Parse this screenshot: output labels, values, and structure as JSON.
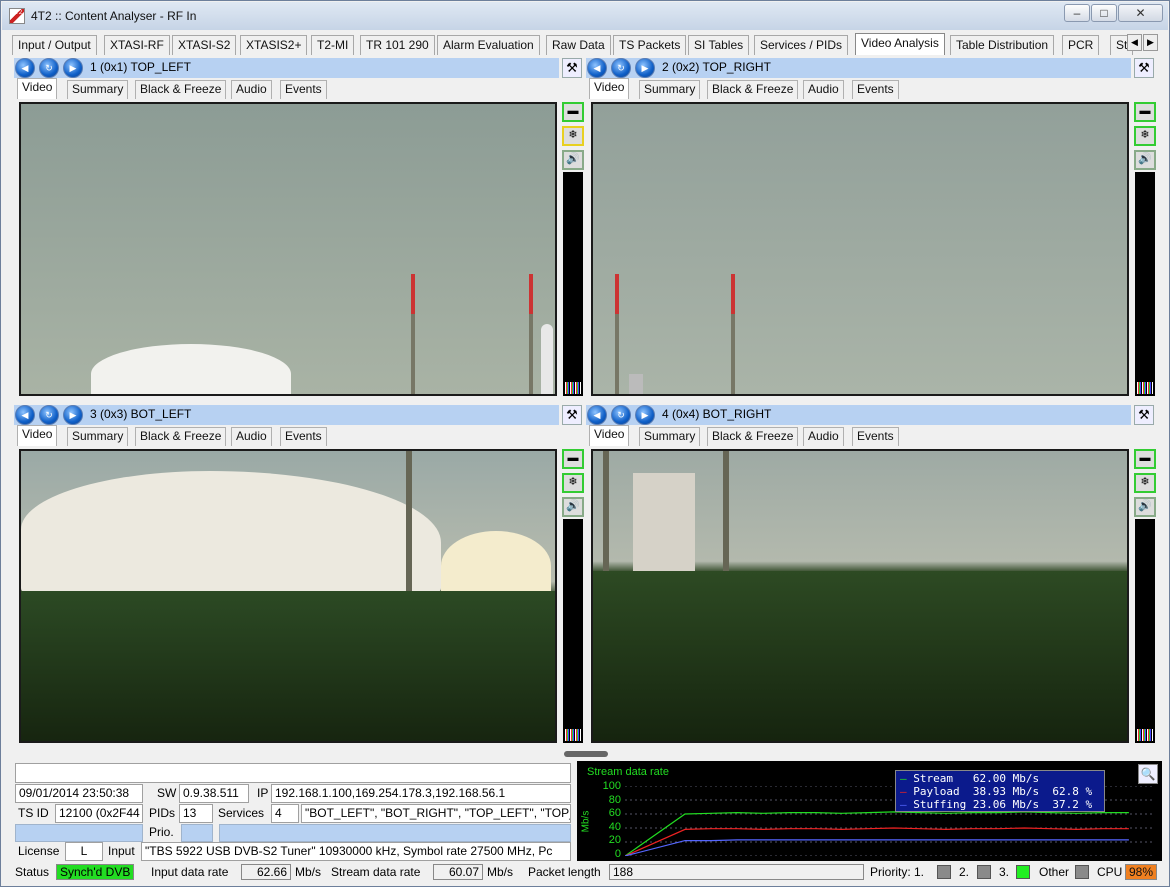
{
  "window": {
    "title": "4T2 :: Content Analyser - RF In",
    "icon": "app-logo-icon"
  },
  "controls": {
    "minimize": "–",
    "maximize": "□",
    "close": "✕"
  },
  "main_tabs": [
    {
      "label": "Input / Output"
    },
    {
      "label": "XTASI-RF"
    },
    {
      "label": "XTASI-S2"
    },
    {
      "label": "XTASIS2+"
    },
    {
      "label": "T2-MI"
    },
    {
      "label": "TR 101 290"
    },
    {
      "label": "Alarm Evaluation"
    },
    {
      "label": "Raw Data"
    },
    {
      "label": "TS Packets"
    },
    {
      "label": "SI Tables"
    },
    {
      "label": "Services / PIDs"
    },
    {
      "label": "Video Analysis",
      "active": true
    },
    {
      "label": "Table Distribution"
    },
    {
      "label": "PCR"
    },
    {
      "label": "St"
    }
  ],
  "panels": [
    {
      "label": "1 (0x1) TOP_LEFT"
    },
    {
      "label": "2 (0x2) TOP_RIGHT"
    },
    {
      "label": "3 (0x3) BOT_LEFT"
    },
    {
      "label": "4 (0x4) BOT_RIGHT"
    }
  ],
  "panel_tabs": [
    "Video",
    "Summary",
    "Black & Freeze",
    "Audio",
    "Events"
  ],
  "info": {
    "datetime": "09/01/2014 23:50:38",
    "sw_label": "SW",
    "sw": "0.9.38.511",
    "ip_label": "IP",
    "ip": "192.168.1.100,169.254.178.3,192.168.56.1",
    "tsid_label": "TS ID",
    "tsid": "12100 (0x2F44",
    "pids_label": "PIDs",
    "pids": "13",
    "services_label": "Services",
    "services": "4",
    "services_list": "\"BOT_LEFT\", \"BOT_RIGHT\", \"TOP_LEFT\", \"TOP_",
    "prio_label": "Prio.",
    "license_label": "License",
    "license": "L",
    "input_label": "Input",
    "input": "\"TBS 5922 USB DVB-S2 Tuner\" 10930000 kHz, Symbol rate 27500 MHz, Pc"
  },
  "graph": {
    "title": "Stream data rate",
    "ylabel": "Mb/s",
    "yticks": [
      "100",
      "80",
      "60",
      "40",
      "20",
      "0"
    ],
    "legend": [
      {
        "name": "Stream",
        "value": "62.00 Mb/s",
        "pct": "",
        "color": "#22dd22"
      },
      {
        "name": "Payload",
        "value": "38.93 Mb/s",
        "pct": "62.8 %",
        "color": "#ee2222"
      },
      {
        "name": "Stuffing",
        "value": "23.06 Mb/s",
        "pct": "37.2 %",
        "color": "#5566ff"
      }
    ]
  },
  "chart_data": {
    "type": "line",
    "title": "Stream data rate",
    "ylabel": "Mb/s",
    "ylim": [
      0,
      100
    ],
    "series": [
      {
        "name": "Stream",
        "values": [
          0,
          60,
          61,
          62,
          61,
          62,
          62,
          61,
          62,
          63,
          62,
          61,
          62,
          62,
          63,
          62,
          61,
          62,
          62
        ]
      },
      {
        "name": "Payload",
        "values": [
          0,
          38,
          39,
          39,
          38,
          39,
          39,
          38,
          39,
          40,
          39,
          38,
          39,
          39,
          40,
          39,
          38,
          39,
          39
        ]
      },
      {
        "name": "Stuffing",
        "values": [
          0,
          22,
          22,
          23,
          23,
          23,
          23,
          23,
          23,
          23,
          23,
          23,
          23,
          23,
          23,
          23,
          23,
          23,
          23
        ]
      }
    ]
  },
  "statusbar": {
    "status_label": "Status",
    "status_value": "Synch'd DVB",
    "input_rate_label": "Input data rate",
    "input_rate": "62.66",
    "input_rate_unit": "Mb/s",
    "stream_rate_label": "Stream data rate",
    "stream_rate": "60.07",
    "stream_rate_unit": "Mb/s",
    "packet_label": "Packet length",
    "packet_length": "188",
    "priority_label": "Priority: 1.",
    "p2": "2.",
    "p3": "3.",
    "other_label": "Other",
    "cpu_label": "CPU",
    "cpu": "98%"
  },
  "colors": {
    "status_ok": "#22dd22",
    "cpu_warn": "#f08020",
    "header_blue": "#b7d1f2"
  }
}
